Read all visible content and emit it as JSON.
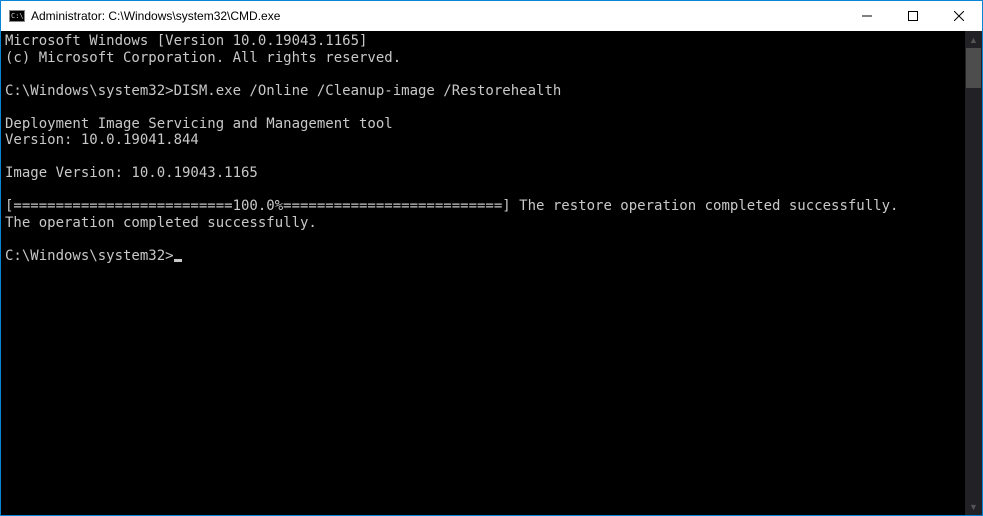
{
  "window": {
    "title": "Administrator: C:\\Windows\\system32\\CMD.exe"
  },
  "terminal": {
    "line1": "Microsoft Windows [Version 10.0.19043.1165]",
    "line2": "(c) Microsoft Corporation. All rights reserved.",
    "blank1": "",
    "prompt1": "C:\\Windows\\system32>DISM.exe /Online /Cleanup-image /Restorehealth",
    "blank2": "",
    "line3": "Deployment Image Servicing and Management tool",
    "line4": "Version: 10.0.19041.844",
    "blank3": "",
    "line5": "Image Version: 10.0.19043.1165",
    "blank4": "",
    "progress": "[==========================100.0%==========================] The restore operation completed successfully.",
    "line6": "The operation completed successfully.",
    "blank5": "",
    "prompt2": "C:\\Windows\\system32>"
  }
}
